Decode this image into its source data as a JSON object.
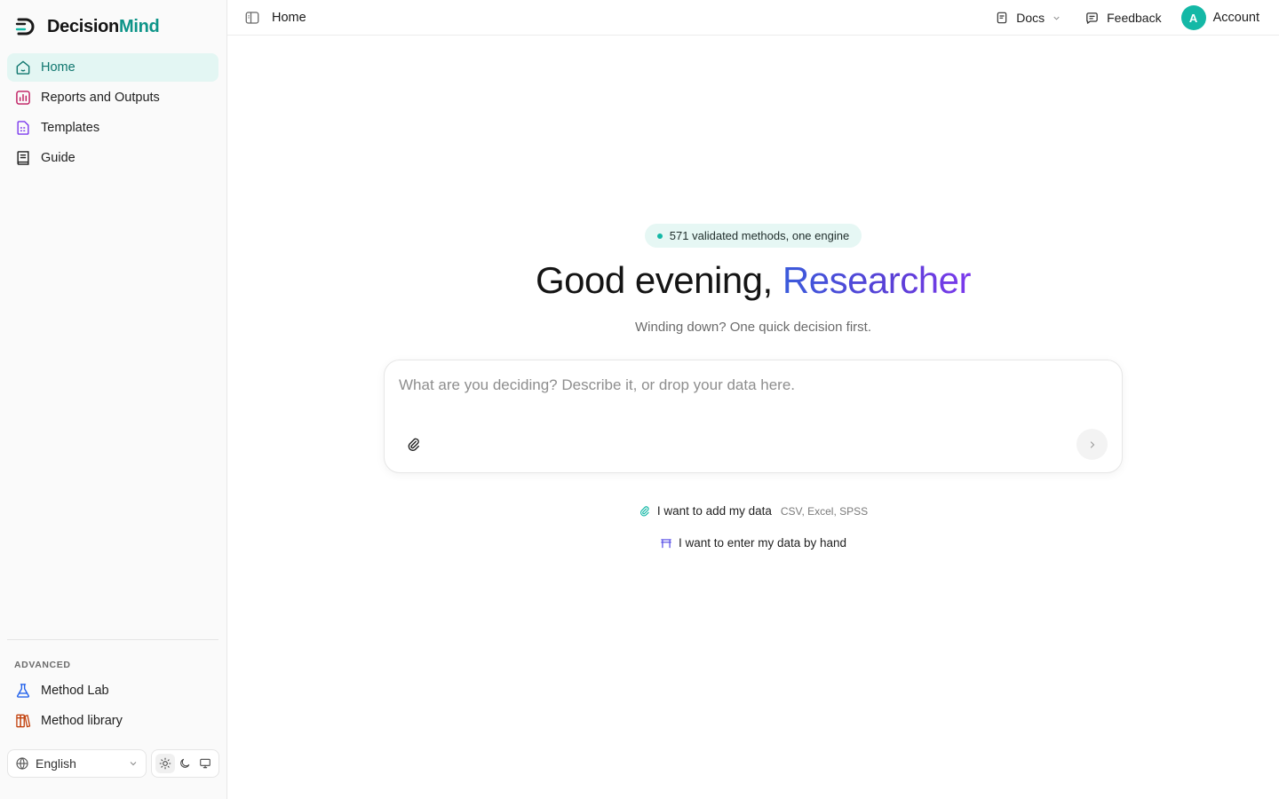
{
  "brand": {
    "name_main": "Decision",
    "name_accent": "Mind",
    "accent_color": "#0d9488"
  },
  "sidebar": {
    "items": [
      {
        "label": "Home",
        "icon": "home-icon",
        "active": true
      },
      {
        "label": "Reports and Outputs",
        "icon": "bar-chart-icon"
      },
      {
        "label": "Templates",
        "icon": "template-icon"
      },
      {
        "label": "Guide",
        "icon": "book-icon"
      }
    ],
    "advanced_label": "ADVANCED",
    "advanced_items": [
      {
        "label": "Method Lab",
        "icon": "flask-icon"
      },
      {
        "label": "Method library",
        "icon": "library-icon"
      }
    ],
    "language": "English",
    "theme_options": [
      "light",
      "dark",
      "system"
    ],
    "theme_selected": "light"
  },
  "topbar": {
    "breadcrumb": "Home",
    "docs_label": "Docs",
    "feedback_label": "Feedback",
    "avatar_initial": "A",
    "account_label": "Account"
  },
  "main": {
    "badge": "571 validated methods, one engine",
    "greeting": "Good evening, ",
    "greeting_name": "Researcher",
    "subline": "Winding down? One quick decision first.",
    "composer_placeholder": "What are you deciding? Describe it, or drop your data here.",
    "quick_actions": [
      {
        "label": "I want to add my data",
        "hint": "CSV, Excel, SPSS",
        "icon": "paperclip-icon"
      },
      {
        "label": "I want to enter my data by hand",
        "icon": "table-icon"
      }
    ]
  },
  "colors": {
    "accent": "#14b8a6",
    "active_bg": "#e3f6f3",
    "gradient_start": "#3b5bdb",
    "gradient_end": "#7c3aed"
  }
}
